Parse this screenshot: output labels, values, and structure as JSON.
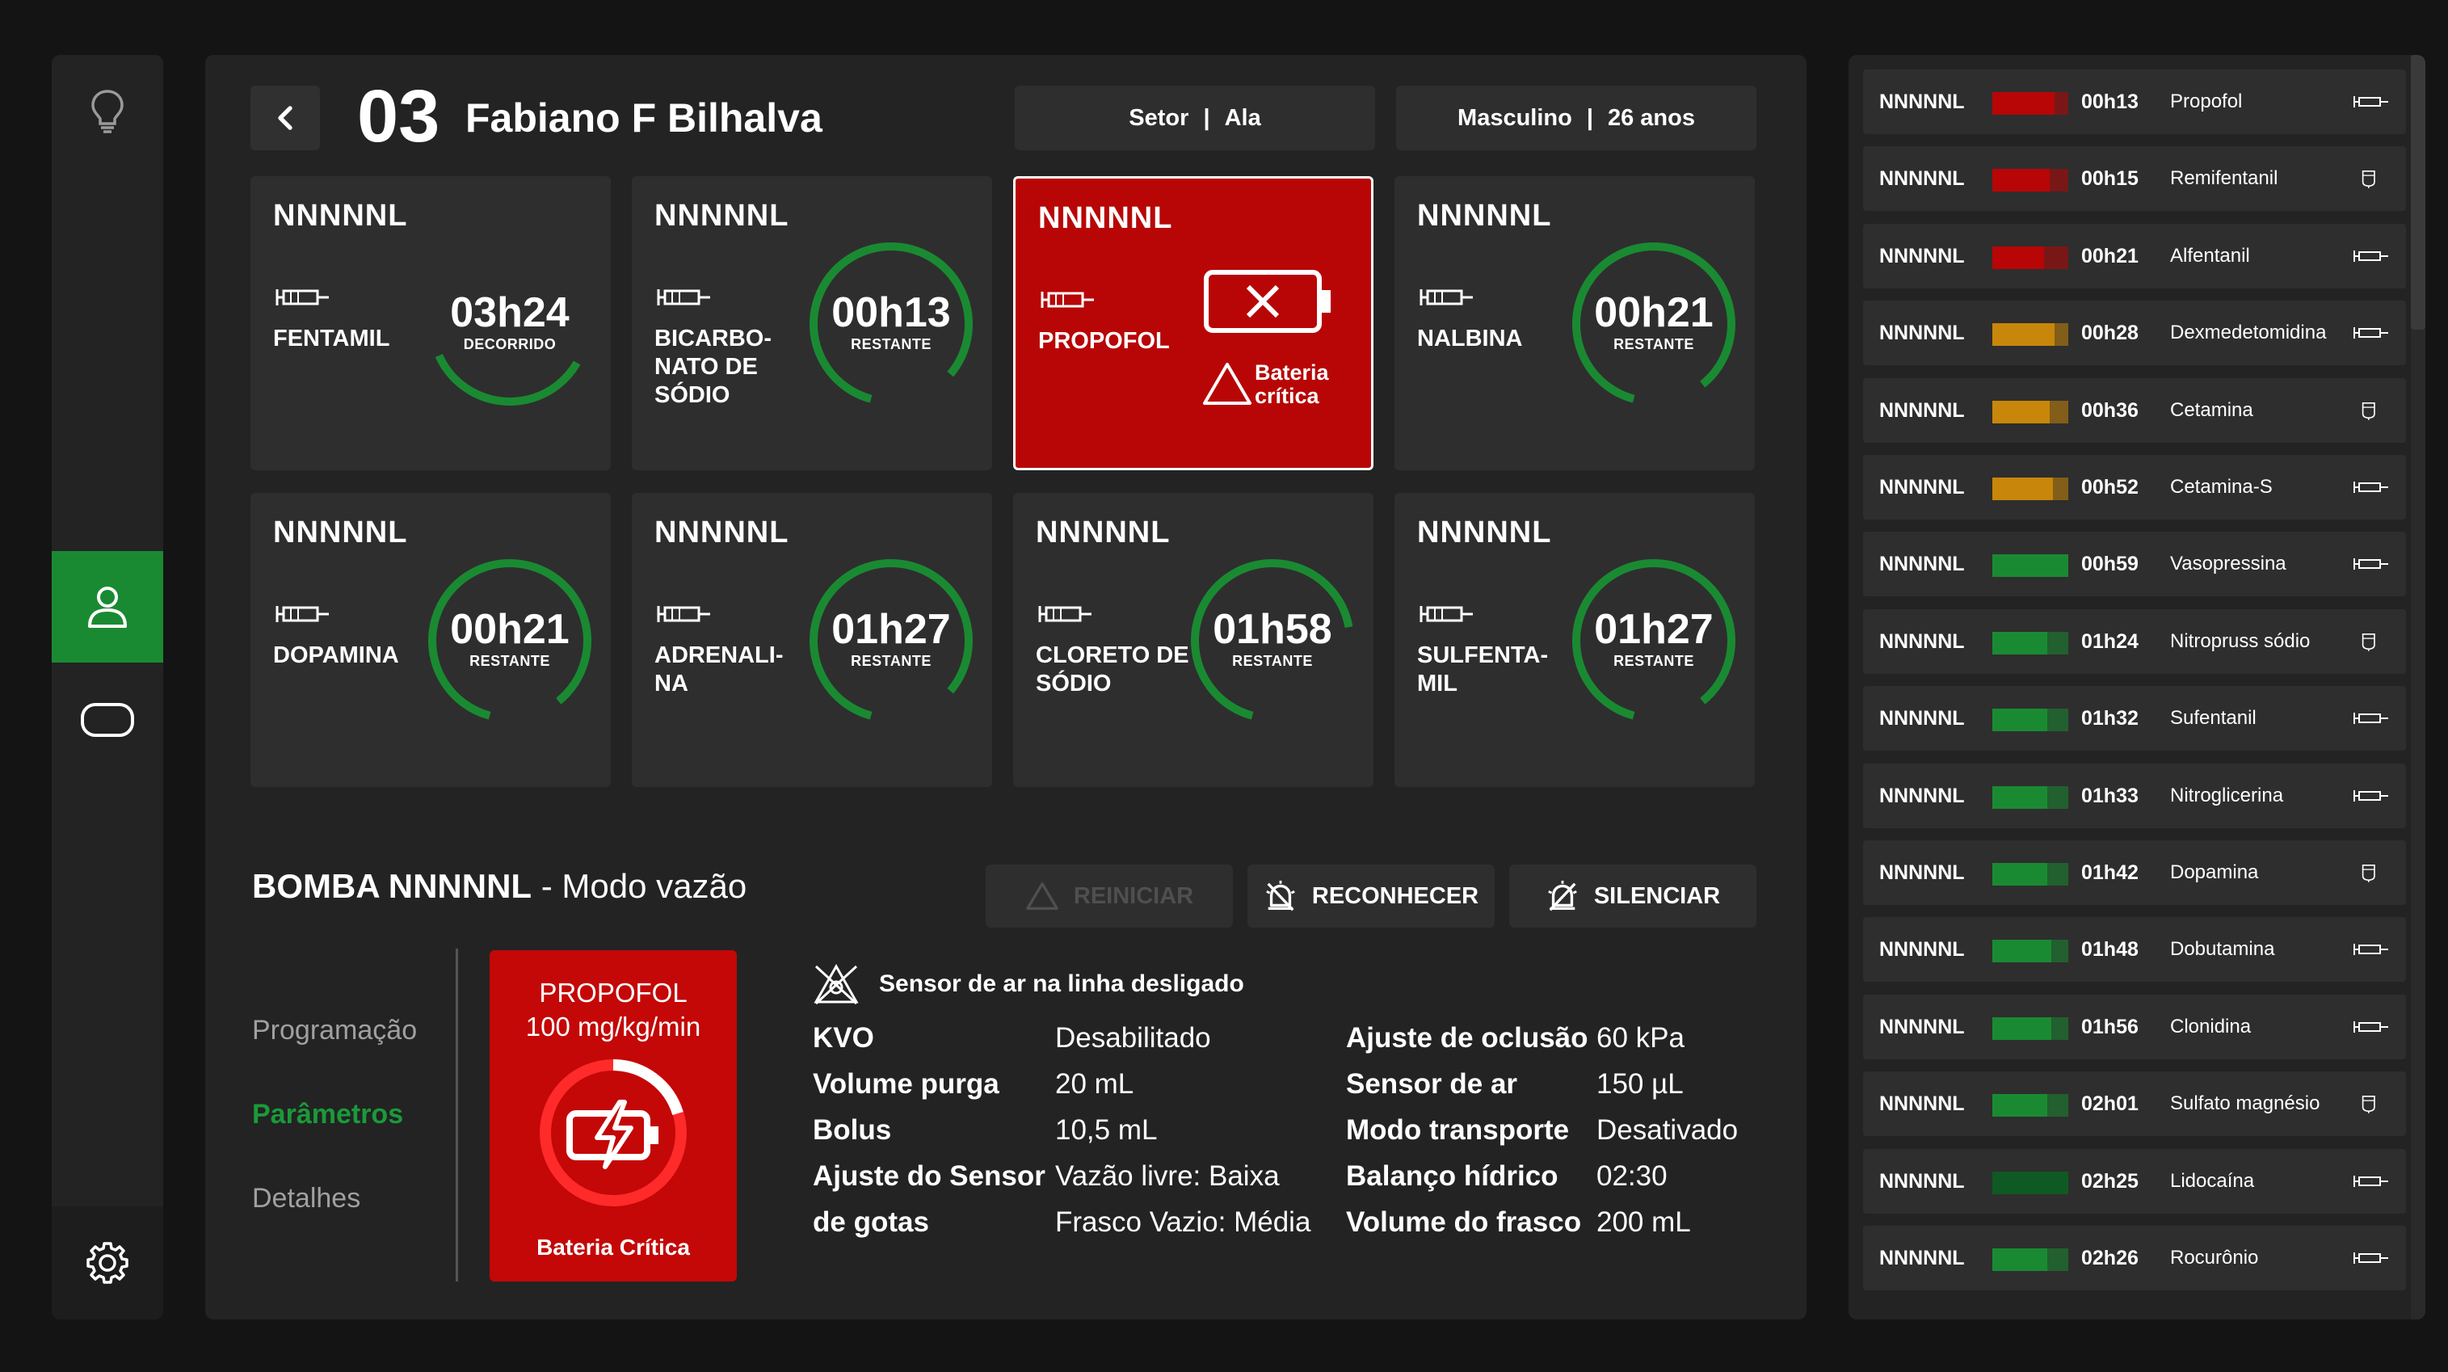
{
  "colors": {
    "accent_green": "#1a8a32",
    "alarm_red": "#b80606",
    "warning_amber": "#c8860a",
    "panel": "#232323",
    "card": "#2e2e2e"
  },
  "rail": {
    "items": [
      {
        "icon": "lightbulb-icon"
      },
      {
        "icon": "user-icon",
        "active": true
      },
      {
        "icon": "monitor-icon"
      }
    ],
    "settings_icon": "gear-icon"
  },
  "header": {
    "bed": "03",
    "patient": "Fabiano F Bilhalva",
    "sector": "Setor",
    "ward": "Ala",
    "sex": "Masculino",
    "age": "26 anos"
  },
  "cards": [
    {
      "code": "NNNNNL",
      "drug": "FENTAMIL",
      "time": "03h24",
      "label": "DECORRIDO",
      "progress": 0.35,
      "state": "normal"
    },
    {
      "code": "NNNNNL",
      "drug": "BICARBO-NATO DE SÓDIO",
      "time": "00h13",
      "label": "RESTANTE",
      "progress": 0.82,
      "state": "normal"
    },
    {
      "code": "NNNNNL",
      "drug": "PROPOFOL",
      "alarm_text": "Bateria crítica",
      "state": "alarm"
    },
    {
      "code": "NNNNNL",
      "drug": "NALBINA",
      "time": "00h21",
      "label": "RESTANTE",
      "progress": 0.85,
      "state": "normal"
    },
    {
      "code": "NNNNNL",
      "drug": "DOPAMINA",
      "time": "00h21",
      "label": "RESTANTE",
      "progress": 0.85,
      "state": "normal"
    },
    {
      "code": "NNNNNL",
      "drug": "ADRENALI-NA",
      "time": "01h27",
      "label": "RESTANTE",
      "progress": 0.82,
      "state": "normal"
    },
    {
      "code": "NNNNNL",
      "drug": "CLORETO DE SÓDIO",
      "time": "01h58",
      "label": "RESTANTE",
      "progress": 0.68,
      "state": "normal"
    },
    {
      "code": "NNNNNL",
      "drug": "SULFENTA-MIL",
      "time": "01h27",
      "label": "RESTANTE",
      "progress": 0.85,
      "state": "normal"
    }
  ],
  "detail": {
    "pump_label": "BOMBA NNNNNL",
    "mode": "- Modo vazão",
    "buttons": {
      "restart": "REINICIAR",
      "acknowledge": "RECONHECER",
      "silence": "SILENCIAR"
    },
    "nav": {
      "programming": "Programação",
      "parameters": "Parâmetros",
      "details": "Detalhes"
    },
    "tile": {
      "drug": "PROPOFOL",
      "dose": "100 mg/kg/min",
      "label": "Bateria Crítica"
    },
    "sensor_note": "Sensor de ar na linha desligado",
    "params_left": [
      {
        "k": "KVO",
        "v": "Desabilitado"
      },
      {
        "k": "Volume purga",
        "v": "20 mL"
      },
      {
        "k": "Bolus",
        "v": "10,5 mL"
      },
      {
        "k": "Ajuste do Sensor",
        "v": "Vazão livre: Baixa"
      },
      {
        "k": "de gotas",
        "v": "Frasco Vazio: Média"
      }
    ],
    "params_right": [
      {
        "k": "Ajuste de oclusão",
        "v": "60 kPa"
      },
      {
        "k": "Sensor de ar",
        "v": "150 µL"
      },
      {
        "k": "Modo transporte",
        "v": "Desativado"
      },
      {
        "k": "Balanço hídrico",
        "v": "02:30"
      },
      {
        "k": "Volume do frasco",
        "v": "200 mL"
      }
    ]
  },
  "list": [
    {
      "code": "NNNNNL",
      "time": "00h13",
      "drug": "Propofol",
      "level": 0.82,
      "color": "#b80606",
      "icon": "syringe-icon"
    },
    {
      "code": "NNNNNL",
      "time": "00h15",
      "drug": "Remifentanil",
      "level": 0.75,
      "color": "#b80606",
      "icon": "bag-icon"
    },
    {
      "code": "NNNNNL",
      "time": "00h21",
      "drug": "Alfentanil",
      "level": 0.68,
      "color": "#b80606",
      "icon": "syringe-icon"
    },
    {
      "code": "NNNNNL",
      "time": "00h28",
      "drug": "Dexmedetomidina",
      "level": 0.82,
      "color": "#c8860a",
      "icon": "syringe-icon"
    },
    {
      "code": "NNNNNL",
      "time": "00h36",
      "drug": "Cetamina",
      "level": 0.75,
      "color": "#c8860a",
      "icon": "bag-icon"
    },
    {
      "code": "NNNNNL",
      "time": "00h52",
      "drug": "Cetamina-S",
      "level": 0.8,
      "color": "#c8860a",
      "icon": "syringe-icon"
    },
    {
      "code": "NNNNNL",
      "time": "00h59",
      "drug": "Vasopressina",
      "level": 1.0,
      "color": "#1a8a32",
      "icon": "syringe-icon"
    },
    {
      "code": "NNNNNL",
      "time": "01h24",
      "drug": "Nitropruss sódio",
      "level": 0.72,
      "color": "#1a8a32",
      "icon": "bag-icon"
    },
    {
      "code": "NNNNNL",
      "time": "01h32",
      "drug": "Sufentanil",
      "level": 0.72,
      "color": "#1a8a32",
      "icon": "syringe-icon"
    },
    {
      "code": "NNNNNL",
      "time": "01h33",
      "drug": "Nitroglicerina",
      "level": 0.72,
      "color": "#1a8a32",
      "icon": "syringe-icon"
    },
    {
      "code": "NNNNNL",
      "time": "01h42",
      "drug": "Dopamina",
      "level": 0.72,
      "color": "#1a8a32",
      "icon": "bag-icon"
    },
    {
      "code": "NNNNNL",
      "time": "01h48",
      "drug": "Dobutamina",
      "level": 0.78,
      "color": "#1a8a32",
      "icon": "syringe-icon"
    },
    {
      "code": "NNNNNL",
      "time": "01h56",
      "drug": "Clonidina",
      "level": 0.78,
      "color": "#1a8a32",
      "icon": "syringe-icon"
    },
    {
      "code": "NNNNNL",
      "time": "02h01",
      "drug": "Sulfato magnésio",
      "level": 0.72,
      "color": "#1a8a32",
      "icon": "bag-icon"
    },
    {
      "code": "NNNNNL",
      "time": "02h25",
      "drug": "Lidocaína",
      "level": 1.0,
      "color": "#0f5a22",
      "icon": "syringe-icon"
    },
    {
      "code": "NNNNNL",
      "time": "02h26",
      "drug": "Rocurônio",
      "level": 0.72,
      "color": "#1a8a32",
      "icon": "syringe-icon"
    }
  ]
}
